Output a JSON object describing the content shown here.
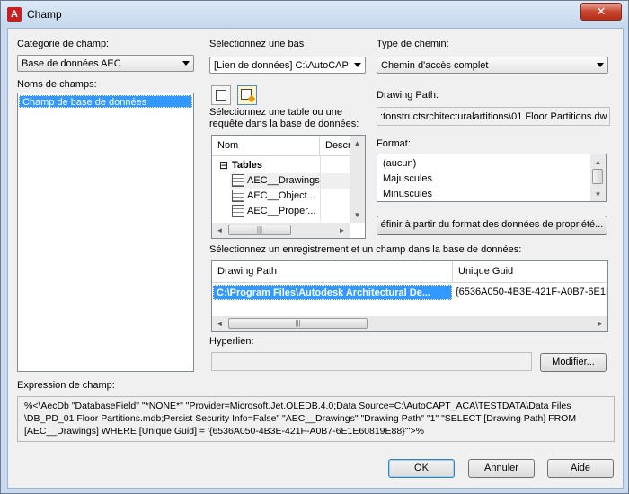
{
  "window": {
    "title": "Champ",
    "close_symbol": "✕"
  },
  "category": {
    "label": "Catégorie de champ:",
    "value": "Base de données AEC"
  },
  "field_names": {
    "label": "Noms de champs:",
    "items": [
      "Champ de base de données"
    ]
  },
  "database": {
    "label": "Sélectionnez une bas",
    "value": "[Lien de données] C:\\AutoCAPT"
  },
  "path_type": {
    "label": "Type de chemin:",
    "value": "Chemin d'accès complet"
  },
  "drawing_path": {
    "label": "Drawing Path:",
    "value": ":tonstructsrchitecturalartitions\\01 Floor Partitions.dw"
  },
  "table_select": {
    "label_line1": "Sélectionnez une table ou une",
    "label_line2": "requête dans la base de données:",
    "col_name": "Nom",
    "col_desc": "Descr",
    "expander": "⊟",
    "group": "Tables",
    "items": [
      "AEC__Drawings",
      "AEC__Object...",
      "AEC__Proper..."
    ]
  },
  "format": {
    "label": "Format:",
    "items": [
      "(aucun)",
      "Majuscules",
      "Minuscules"
    ]
  },
  "define_format_button": "éfinir à partir du format des données de propriété...",
  "record_select": {
    "label": "Sélectionnez un enregistrement et un champ dans la base de données:",
    "columns": [
      "Drawing Path",
      "Unique Guid"
    ],
    "row": [
      "C:\\Program Files\\Autodesk Architectural De...",
      "{6536A050-4B3E-421F-A0B7-6E1E"
    ]
  },
  "hyperlink": {
    "label": "Hyperlien:",
    "value": "",
    "modify_button": "Modifier..."
  },
  "expression": {
    "label": "Expression de champ:",
    "line1": "%<\\AecDb \"DatabaseField\" \"*NONE*\" \"Provider=Microsoft.Jet.OLEDB.4.0;Data Source=C:\\AutoCAPT_ACA\\TESTDATA\\Data Files",
    "line2": "\\DB_PD_01 Floor Partitions.mdb;Persist Security Info=False\" \"AEC__Drawings\" \"Drawing Path\" \"1\" \"SELECT [Drawing Path] FROM",
    "line3": "[AEC__Drawings] WHERE [Unique Guid] = '{6536A050-4B3E-421F-A0B7-6E1E60819E88}'\">%"
  },
  "buttons": {
    "ok": "OK",
    "cancel": "Annuler",
    "help": "Aide"
  },
  "icons": {
    "scroll_left": "◄",
    "scroll_right": "►",
    "scroll_up": "▲",
    "scroll_down": "▼",
    "grip": "|||"
  }
}
